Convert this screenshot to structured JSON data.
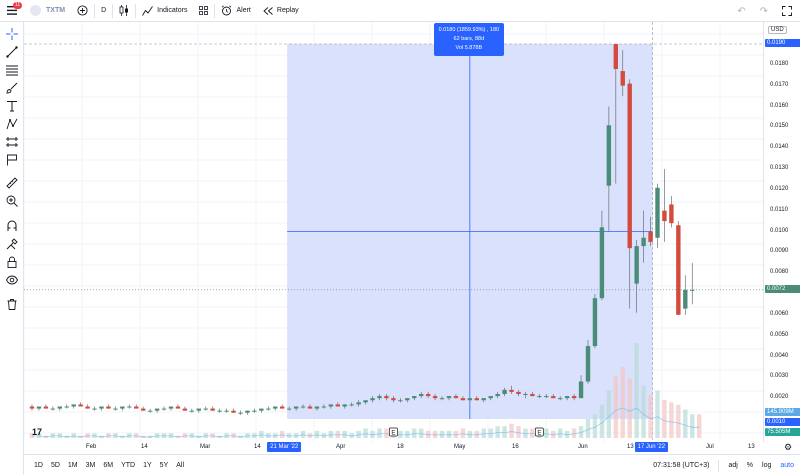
{
  "toolbar": {
    "notifications": "11",
    "symbol": "TXTM",
    "interval": "D",
    "indicators_label": "Indicators",
    "alert_label": "Alert",
    "replay_label": "Replay"
  },
  "left_tools": [
    "crosshair-icon",
    "trend-line-icon",
    "fib-icon",
    "brush-icon",
    "text-icon",
    "pattern-icon",
    "prediction-icon",
    "flag-icon",
    "ruler-icon",
    "zoom-icon",
    "magnet-icon",
    "lock-drawing-icon",
    "lock-icon",
    "eye-icon",
    "trash-icon"
  ],
  "measure_tooltip": {
    "line1": "0.0180 (1859.93%) , 180",
    "line2": "62 bars, 88d",
    "line3": "Vol 5.878B"
  },
  "price_axis": {
    "currency": "USD",
    "ticks": [
      "0.0180",
      "0.0170",
      "0.0160",
      "0.0150",
      "0.0140",
      "0.0130",
      "0.0120",
      "0.0110",
      "0.0100",
      "0.0090",
      "0.0080",
      "0.0060",
      "0.0050",
      "0.0040",
      "0.0030",
      "0.0020"
    ],
    "high_label": "0.0190",
    "current_label": "0.0072",
    "low_label": "0.0010",
    "vol_label": "75.505M",
    "vol_label2": "145.909M"
  },
  "time_axis": {
    "ticks": [
      "Feb",
      "14",
      "Mar",
      "14",
      "Apr",
      "18",
      "May",
      "16",
      "Jun",
      "13",
      "Jul",
      "13"
    ],
    "start_label": "21 Mar '22",
    "end_label": "17 Jun '22"
  },
  "bottom": {
    "ranges": [
      "1D",
      "5D",
      "1M",
      "3M",
      "6M",
      "YTD",
      "1Y",
      "5Y",
      "All"
    ],
    "time": "07:31:58 (UTC+3)",
    "pct": "%",
    "adj": "adj",
    "log": "log",
    "auto": "auto"
  },
  "colors": {
    "up": "#26a69a",
    "down": "#ef5350",
    "up_dark": "#4a8c78",
    "down_dark": "#d34b3d",
    "measure_fill": "#d2dcfb",
    "accent": "#2962ff",
    "bg": "#ffffff",
    "grid": "#f0f3fa"
  },
  "chart_data": {
    "type": "candlestick",
    "candles": [
      {
        "o": 0.0016,
        "h": 0.0017,
        "l": 0.0014,
        "c": 0.0015
      },
      {
        "o": 0.0015,
        "h": 0.0016,
        "l": 0.0014,
        "c": 0.0016
      },
      {
        "o": 0.0016,
        "h": 0.0017,
        "l": 0.0015,
        "c": 0.0015
      },
      {
        "o": 0.0015,
        "h": 0.0016,
        "l": 0.0014,
        "c": 0.0015
      },
      {
        "o": 0.0015,
        "h": 0.0016,
        "l": 0.0014,
        "c": 0.0016
      },
      {
        "o": 0.0016,
        "h": 0.0017,
        "l": 0.0015,
        "c": 0.0016
      },
      {
        "o": 0.0016,
        "h": 0.0017,
        "l": 0.0015,
        "c": 0.0017
      },
      {
        "o": 0.0017,
        "h": 0.0018,
        "l": 0.0016,
        "c": 0.0016
      },
      {
        "o": 0.0016,
        "h": 0.0017,
        "l": 0.0015,
        "c": 0.0015
      },
      {
        "o": 0.0015,
        "h": 0.0016,
        "l": 0.0014,
        "c": 0.0015
      },
      {
        "o": 0.0015,
        "h": 0.0016,
        "l": 0.0014,
        "c": 0.0016
      },
      {
        "o": 0.0016,
        "h": 0.0017,
        "l": 0.0015,
        "c": 0.0015
      },
      {
        "o": 0.0015,
        "h": 0.0016,
        "l": 0.0014,
        "c": 0.0015
      },
      {
        "o": 0.0015,
        "h": 0.0016,
        "l": 0.0014,
        "c": 0.0016
      },
      {
        "o": 0.0016,
        "h": 0.0017,
        "l": 0.0015,
        "c": 0.0016
      },
      {
        "o": 0.0016,
        "h": 0.0017,
        "l": 0.0015,
        "c": 0.0015
      },
      {
        "o": 0.0015,
        "h": 0.0016,
        "l": 0.0014,
        "c": 0.0014
      },
      {
        "o": 0.0014,
        "h": 0.0015,
        "l": 0.0013,
        "c": 0.0014
      },
      {
        "o": 0.0014,
        "h": 0.0015,
        "l": 0.0013,
        "c": 0.0015
      },
      {
        "o": 0.0015,
        "h": 0.0016,
        "l": 0.0014,
        "c": 0.0015
      },
      {
        "o": 0.0015,
        "h": 0.0016,
        "l": 0.0014,
        "c": 0.0016
      },
      {
        "o": 0.0016,
        "h": 0.0017,
        "l": 0.0015,
        "c": 0.0015
      },
      {
        "o": 0.0015,
        "h": 0.0016,
        "l": 0.0014,
        "c": 0.0014
      },
      {
        "o": 0.0014,
        "h": 0.0015,
        "l": 0.0013,
        "c": 0.0014
      },
      {
        "o": 0.0014,
        "h": 0.0015,
        "l": 0.0013,
        "c": 0.0015
      },
      {
        "o": 0.0015,
        "h": 0.0016,
        "l": 0.0014,
        "c": 0.0015
      },
      {
        "o": 0.0015,
        "h": 0.0016,
        "l": 0.0014,
        "c": 0.0014
      },
      {
        "o": 0.0014,
        "h": 0.0015,
        "l": 0.0013,
        "c": 0.0014
      },
      {
        "o": 0.0014,
        "h": 0.0015,
        "l": 0.0013,
        "c": 0.0014
      },
      {
        "o": 0.0014,
        "h": 0.0015,
        "l": 0.0013,
        "c": 0.0013
      },
      {
        "o": 0.0013,
        "h": 0.0014,
        "l": 0.0012,
        "c": 0.0013
      },
      {
        "o": 0.0013,
        "h": 0.0014,
        "l": 0.0012,
        "c": 0.0014
      },
      {
        "o": 0.0014,
        "h": 0.0015,
        "l": 0.0013,
        "c": 0.0014
      },
      {
        "o": 0.0014,
        "h": 0.0015,
        "l": 0.0013,
        "c": 0.0015
      },
      {
        "o": 0.0015,
        "h": 0.0016,
        "l": 0.0014,
        "c": 0.0015
      },
      {
        "o": 0.0015,
        "h": 0.0016,
        "l": 0.0014,
        "c": 0.0016
      },
      {
        "o": 0.0016,
        "h": 0.0017,
        "l": 0.0015,
        "c": 0.0015
      },
      {
        "o": 0.0015,
        "h": 0.0016,
        "l": 0.0014,
        "c": 0.0015
      },
      {
        "o": 0.0015,
        "h": 0.0016,
        "l": 0.0014,
        "c": 0.0016
      },
      {
        "o": 0.0016,
        "h": 0.0017,
        "l": 0.0015,
        "c": 0.0016
      },
      {
        "o": 0.0016,
        "h": 0.0017,
        "l": 0.0015,
        "c": 0.0015
      },
      {
        "o": 0.0015,
        "h": 0.0016,
        "l": 0.0014,
        "c": 0.0016
      },
      {
        "o": 0.0016,
        "h": 0.0017,
        "l": 0.0015,
        "c": 0.0016
      },
      {
        "o": 0.0016,
        "h": 0.0017,
        "l": 0.0015,
        "c": 0.0017
      },
      {
        "o": 0.0017,
        "h": 0.0018,
        "l": 0.0016,
        "c": 0.0016
      },
      {
        "o": 0.0016,
        "h": 0.0017,
        "l": 0.0015,
        "c": 0.0017
      },
      {
        "o": 0.0017,
        "h": 0.0018,
        "l": 0.0016,
        "c": 0.0017
      },
      {
        "o": 0.0017,
        "h": 0.0019,
        "l": 0.0016,
        "c": 0.0018
      },
      {
        "o": 0.0018,
        "h": 0.0019,
        "l": 0.0017,
        "c": 0.0019
      },
      {
        "o": 0.0019,
        "h": 0.0021,
        "l": 0.0018,
        "c": 0.002
      },
      {
        "o": 0.002,
        "h": 0.0022,
        "l": 0.0019,
        "c": 0.0021
      },
      {
        "o": 0.0021,
        "h": 0.0022,
        "l": 0.0019,
        "c": 0.002
      },
      {
        "o": 0.002,
        "h": 0.0021,
        "l": 0.0018,
        "c": 0.0019
      },
      {
        "o": 0.0019,
        "h": 0.002,
        "l": 0.0018,
        "c": 0.0019
      },
      {
        "o": 0.0019,
        "h": 0.002,
        "l": 0.0018,
        "c": 0.002
      },
      {
        "o": 0.002,
        "h": 0.0021,
        "l": 0.0019,
        "c": 0.0021
      },
      {
        "o": 0.0021,
        "h": 0.0023,
        "l": 0.002,
        "c": 0.0022
      },
      {
        "o": 0.0022,
        "h": 0.0023,
        "l": 0.002,
        "c": 0.0021
      },
      {
        "o": 0.0021,
        "h": 0.0022,
        "l": 0.0019,
        "c": 0.002
      },
      {
        "o": 0.002,
        "h": 0.0021,
        "l": 0.0019,
        "c": 0.002
      },
      {
        "o": 0.002,
        "h": 0.0021,
        "l": 0.0019,
        "c": 0.0021
      },
      {
        "o": 0.0021,
        "h": 0.0022,
        "l": 0.002,
        "c": 0.002
      },
      {
        "o": 0.002,
        "h": 0.0021,
        "l": 0.0019,
        "c": 0.0019
      },
      {
        "o": 0.0019,
        "h": 0.002,
        "l": 0.0018,
        "c": 0.002
      },
      {
        "o": 0.002,
        "h": 0.0021,
        "l": 0.0019,
        "c": 0.0019
      },
      {
        "o": 0.0019,
        "h": 0.002,
        "l": 0.0018,
        "c": 0.002
      },
      {
        "o": 0.002,
        "h": 0.0021,
        "l": 0.0019,
        "c": 0.0021
      },
      {
        "o": 0.0021,
        "h": 0.0023,
        "l": 0.002,
        "c": 0.0022
      },
      {
        "o": 0.0022,
        "h": 0.0025,
        "l": 0.0021,
        "c": 0.0024
      },
      {
        "o": 0.0024,
        "h": 0.0026,
        "l": 0.0022,
        "c": 0.0023
      },
      {
        "o": 0.0023,
        "h": 0.0024,
        "l": 0.0021,
        "c": 0.0022
      },
      {
        "o": 0.0022,
        "h": 0.0023,
        "l": 0.002,
        "c": 0.0022
      },
      {
        "o": 0.0022,
        "h": 0.0023,
        "l": 0.0021,
        "c": 0.0021
      },
      {
        "o": 0.0021,
        "h": 0.0022,
        "l": 0.002,
        "c": 0.0021
      },
      {
        "o": 0.0021,
        "h": 0.0022,
        "l": 0.002,
        "c": 0.0021
      },
      {
        "o": 0.0021,
        "h": 0.0022,
        "l": 0.002,
        "c": 0.002
      },
      {
        "o": 0.002,
        "h": 0.0021,
        "l": 0.0019,
        "c": 0.002
      },
      {
        "o": 0.002,
        "h": 0.0021,
        "l": 0.0019,
        "c": 0.0021
      },
      {
        "o": 0.0021,
        "h": 0.0022,
        "l": 0.0019,
        "c": 0.002
      },
      {
        "o": 0.002,
        "h": 0.0031,
        "l": 0.002,
        "c": 0.0028
      },
      {
        "o": 0.0028,
        "h": 0.0048,
        "l": 0.0027,
        "c": 0.0045
      },
      {
        "o": 0.0045,
        "h": 0.007,
        "l": 0.0044,
        "c": 0.0068
      },
      {
        "o": 0.0068,
        "h": 0.011,
        "l": 0.0067,
        "c": 0.0102
      },
      {
        "o": 0.0122,
        "h": 0.016,
        "l": 0.01,
        "c": 0.0151
      },
      {
        "o": 0.019,
        "h": 0.019,
        "l": 0.0123,
        "c": 0.0178
      },
      {
        "o": 0.0177,
        "h": 0.0187,
        "l": 0.0165,
        "c": 0.017
      },
      {
        "o": 0.0171,
        "h": 0.0173,
        "l": 0.0063,
        "c": 0.0092
      },
      {
        "o": 0.0075,
        "h": 0.0096,
        "l": 0.0061,
        "c": 0.0093
      },
      {
        "o": 0.0093,
        "h": 0.011,
        "l": 0.0085,
        "c": 0.0097
      },
      {
        "o": 0.01,
        "h": 0.0107,
        "l": 0.0093,
        "c": 0.0095
      },
      {
        "o": 0.0097,
        "h": 0.0123,
        "l": 0.0092,
        "c": 0.0121
      },
      {
        "o": 0.011,
        "h": 0.013,
        "l": 0.0095,
        "c": 0.0105
      },
      {
        "o": 0.0113,
        "h": 0.0117,
        "l": 0.0102,
        "c": 0.0104
      },
      {
        "o": 0.0103,
        "h": 0.0105,
        "l": 0.006,
        "c": 0.006
      },
      {
        "o": 0.0063,
        "h": 0.0079,
        "l": 0.006,
        "c": 0.0072
      },
      {
        "o": 0.0072,
        "h": 0.0085,
        "l": 0.0065,
        "c": 0.0072
      }
    ],
    "volume": [
      2,
      2,
      1,
      2,
      2,
      1,
      2,
      1,
      2,
      2,
      1,
      2,
      2,
      1,
      2,
      2,
      1,
      1,
      2,
      2,
      2,
      1,
      2,
      2,
      1,
      2,
      2,
      1,
      2,
      2,
      1,
      2,
      2,
      3,
      2,
      2,
      3,
      2,
      2,
      3,
      2,
      3,
      2,
      3,
      3,
      3,
      2,
      3,
      4,
      3,
      4,
      4,
      3,
      3,
      3,
      4,
      4,
      3,
      3,
      3,
      3,
      3,
      4,
      3,
      3,
      4,
      4,
      5,
      5,
      6,
      5,
      4,
      4,
      4,
      4,
      3,
      4,
      3,
      4,
      5,
      8,
      10,
      14,
      20,
      26,
      30,
      25,
      40,
      22,
      18,
      20,
      16,
      15,
      14,
      12,
      10,
      10
    ],
    "ylim": [
      0.001,
      0.0195
    ],
    "measure": {
      "from": 0.001,
      "to": 0.019,
      "change": "0.0180 (1859.93%) , 180",
      "bars": 62,
      "days": 88
    }
  }
}
